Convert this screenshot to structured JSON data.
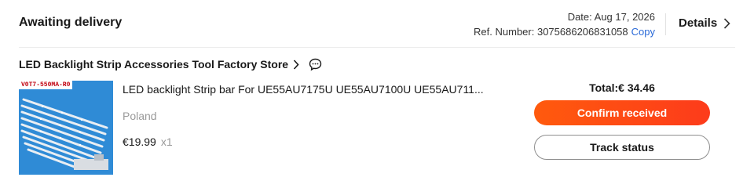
{
  "order": {
    "status": "Awaiting delivery",
    "date_label": "Date: Aug 17, 2026",
    "ref_label": "Ref. Number: 3075686206831058",
    "copy_label": "Copy",
    "details_label": "Details"
  },
  "store": {
    "name": "LED Backlight Strip Accessories Tool Factory Store"
  },
  "item": {
    "image_tag": "V0T7-550MA-R0",
    "title": "LED backlight Strip bar For UE55AU7175U UE55AU7100U UE55AU711...",
    "ship_from": "Poland",
    "price": "€19.99",
    "quantity": "x1"
  },
  "summary": {
    "total": "Total:€ 34.46"
  },
  "actions": {
    "confirm_label": "Confirm received",
    "track_label": "Track status"
  },
  "colors": {
    "primary_button": "#fd4a0a",
    "link": "#2a6ad8",
    "image_bg": "#2f8bd6"
  }
}
